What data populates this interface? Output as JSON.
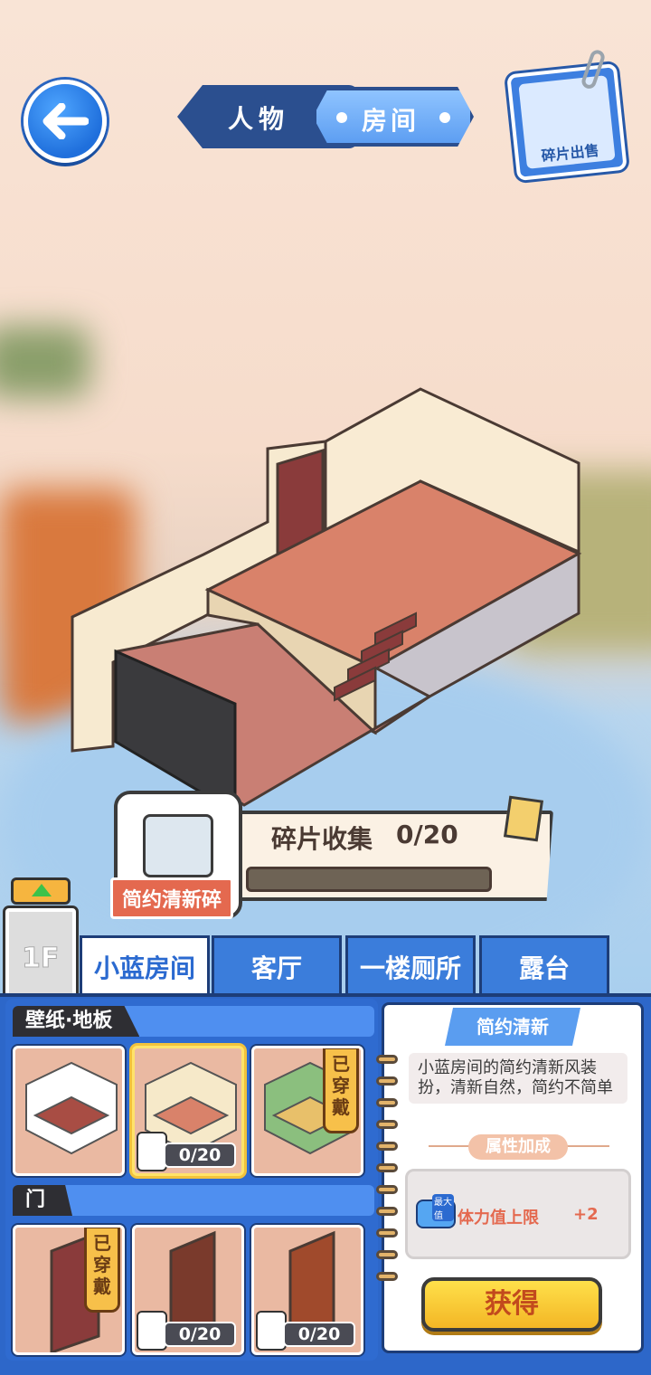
{
  "header": {
    "tabs": [
      "人物",
      "房间"
    ],
    "active_tab": "房间",
    "sell_label": "碎片出售"
  },
  "collect": {
    "title": "碎片收集",
    "count": "0/20",
    "progress": 0,
    "fragment_name": "简约清新碎"
  },
  "floor": {
    "label": "1F"
  },
  "room_tabs": [
    "小蓝房间",
    "客厅",
    "一楼厕所",
    "露台"
  ],
  "active_room_tab": "小蓝房间",
  "sections": {
    "wallpaper_floor": {
      "title": "壁纸·地板",
      "items": [
        {
          "count": "",
          "worn": ""
        },
        {
          "count": "0/20",
          "worn": ""
        },
        {
          "count": "",
          "worn": "已穿戴"
        }
      ]
    },
    "door": {
      "title": "门",
      "items": [
        {
          "count": "",
          "worn": "已穿戴"
        },
        {
          "count": "0/20",
          "worn": ""
        },
        {
          "count": "0/20",
          "worn": ""
        }
      ]
    }
  },
  "detail": {
    "title": "简约清新",
    "description": "小蓝房间的简约清新风装扮，清新自然，简约不简单",
    "attr_header": "属性加成",
    "attr_icon_tag": "最大值",
    "attr_name": "体力值上限",
    "attr_value": "+2",
    "get_label": "获得"
  },
  "colors": {
    "accent_blue": "#3b7ddb",
    "button_yellow": "#f3b625",
    "attr_red": "#e4694f"
  }
}
